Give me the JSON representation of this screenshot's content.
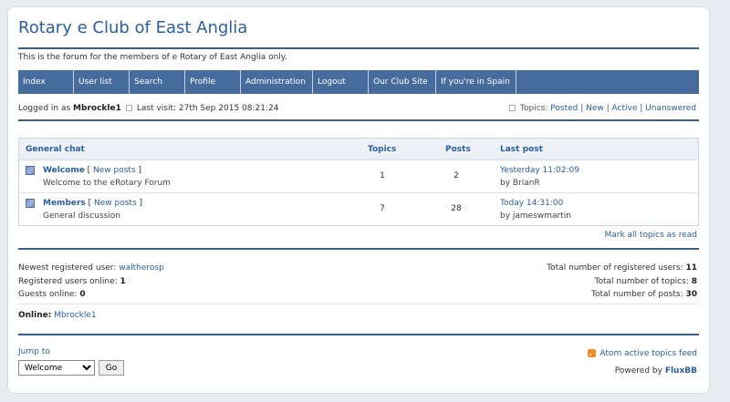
{
  "header": {
    "title": "Rotary e Club of East Anglia",
    "description": "This is the forum for the members of e Rotary of East Anglia only."
  },
  "nav": [
    {
      "label": "Index"
    },
    {
      "label": "User list"
    },
    {
      "label": "Search"
    },
    {
      "label": "Profile"
    },
    {
      "label": "Administration"
    },
    {
      "label": "Logout"
    },
    {
      "label": "Our Club Site"
    },
    {
      "label": "If you're in Spain"
    }
  ],
  "status": {
    "logged_in_prefix": "Logged in as",
    "username": "Mbrockle1",
    "last_visit": "Last visit: 27th Sep 2015 08:21:24",
    "topics_label": "Topics:",
    "links": [
      "Posted",
      "New",
      "Active",
      "Unanswered"
    ]
  },
  "table": {
    "headers": {
      "category": "General chat",
      "topics": "Topics",
      "posts": "Posts",
      "last_post": "Last post"
    },
    "rows": [
      {
        "name": "Welcome",
        "new_posts": "New posts",
        "description": "Welcome to the eRotary Forum",
        "topics": "1",
        "posts": "2",
        "last_post_time": "Yesterday 11:02:09",
        "last_post_by": "by BrianR"
      },
      {
        "name": "Members",
        "new_posts": "New posts",
        "description": "General discussion",
        "topics": "7",
        "posts": "28",
        "last_post_time": "Today 14:31:00",
        "last_post_by": "by jameswmartin"
      }
    ]
  },
  "mark_all": "Mark all topics as read",
  "stats": {
    "newest_label": "Newest registered user:",
    "newest_user": "waltherosp",
    "registered_online_label": "Registered users online:",
    "registered_online": "1",
    "guests_label": "Guests online:",
    "guests": "0",
    "total_users_label": "Total number of registered users:",
    "total_users": "11",
    "total_topics_label": "Total number of topics:",
    "total_topics": "8",
    "total_posts_label": "Total number of posts:",
    "total_posts": "30",
    "online_label": "Online:",
    "online_user": "Mbrockle1"
  },
  "footer": {
    "jump_to": "Jump to",
    "jump_selected": "Welcome",
    "go": "Go",
    "feed": "Atom active topics feed",
    "powered_by": "Powered by",
    "powered_name": "FluxBB"
  },
  "colors": {
    "accent": "#2a5f9e",
    "nav_bg": "#466c9e",
    "rss": "#f08a24"
  }
}
